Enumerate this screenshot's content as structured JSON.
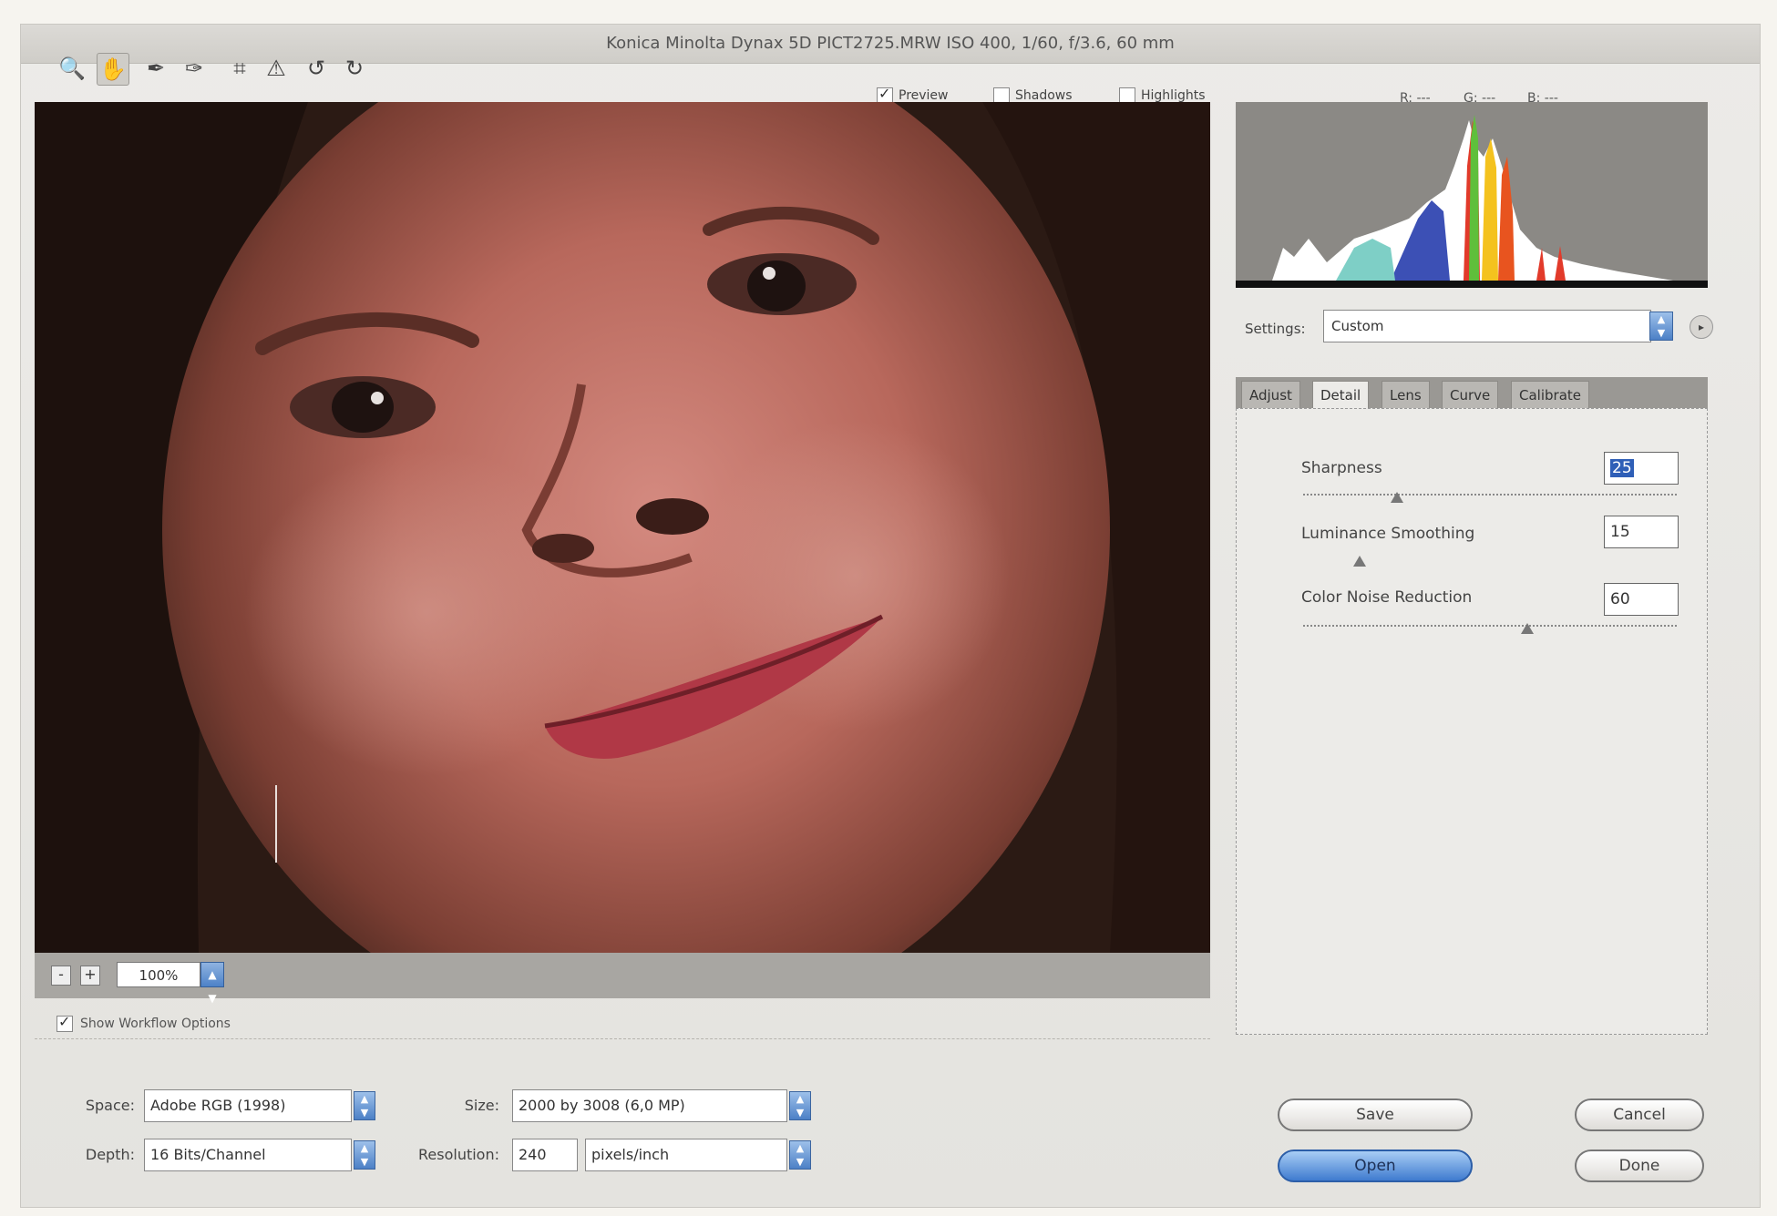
{
  "window": {
    "title": "Konica Minolta Dynax 5D   PICT2725.MRW  ISO 400, 1/60, f/3.6, 60 mm"
  },
  "toolbar": {
    "tools": [
      "zoom-icon",
      "hand-icon",
      "white-balance-icon",
      "color-sampler-icon",
      "crop-icon",
      "straighten-icon",
      "rotate-left-icon",
      "rotate-right-icon"
    ],
    "preview_label": "Preview",
    "preview_checked": true,
    "shadows_label": "Shadows",
    "shadows_checked": false,
    "highlights_label": "Highlights",
    "highlights_checked": false,
    "rgb": {
      "r": "R: ---",
      "g": "G: ---",
      "b": "B: ---"
    }
  },
  "preview": {
    "zoom_value": "100%",
    "zoom_out_label": "-",
    "zoom_in_label": "+"
  },
  "workflow": {
    "show_options_label": "Show Workflow Options",
    "show_options_checked": true,
    "space_label": "Space:",
    "space_value": "Adobe RGB (1998)",
    "depth_label": "Depth:",
    "depth_value": "16 Bits/Channel",
    "size_label": "Size:",
    "size_value": "2000 by 3008 (6,0 MP)",
    "resolution_label": "Resolution:",
    "resolution_value": "240",
    "resolution_unit": "pixels/inch"
  },
  "settings": {
    "label": "Settings:",
    "value": "Custom"
  },
  "tabs": [
    {
      "label": "Adjust",
      "active": false
    },
    {
      "label": "Detail",
      "active": true
    },
    {
      "label": "Lens",
      "active": false
    },
    {
      "label": "Curve",
      "active": false
    },
    {
      "label": "Calibrate",
      "active": false
    }
  ],
  "detail": {
    "sharpness": {
      "label": "Sharpness",
      "value": "25",
      "level": 0.25
    },
    "luminance": {
      "label": "Luminance Smoothing",
      "value": "15",
      "level": 0.15
    },
    "color_noise": {
      "label": "Color Noise Reduction",
      "value": "60",
      "level": 0.6
    }
  },
  "buttons": {
    "save": "Save",
    "open": "Open",
    "cancel": "Cancel",
    "done": "Done"
  },
  "colors": {
    "accent": "#4c80c6",
    "preview_bg": "#2a1a14"
  }
}
